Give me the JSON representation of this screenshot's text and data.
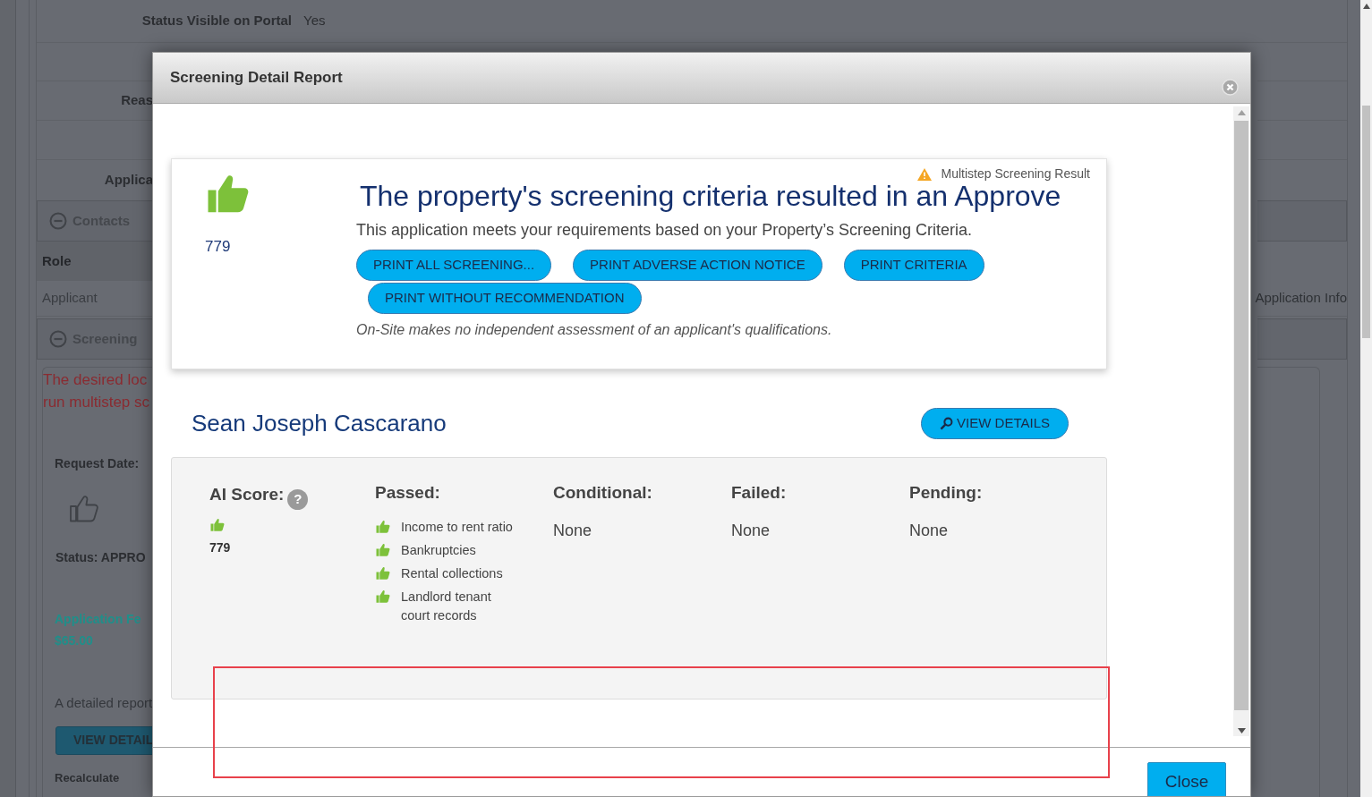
{
  "background": {
    "status_field": {
      "label": "Status Visible on Portal",
      "value": "Yes"
    },
    "labels": [
      "Reas",
      "Applica"
    ],
    "contacts_section": {
      "title": "Contacts",
      "expanded": true,
      "column": "Role",
      "cell": "Applicant"
    },
    "screening_section": {
      "title": "Screening",
      "expanded": true,
      "alert_lines": [
        "The desired loc",
        "run multistep sc"
      ],
      "request_date": "Request Date:",
      "status": "Status: APPRO",
      "fee_label": "Application Fe",
      "fee_value": "$65.00",
      "report_text": "A detailed report",
      "button": "VIEW DETAIL",
      "footer_label": "Recalculate"
    },
    "right_label": "Application Info"
  },
  "modal": {
    "title": "Screening Detail Report",
    "result": {
      "badge": "Multistep Screening Result",
      "score": "779",
      "headline": "The property's screening criteria resulted in an Approve",
      "subtitle": "This application meets your requirements based on your Property’s Screening Criteria.",
      "buttons": [
        "PRINT ALL SCREENING...",
        "PRINT ADVERSE ACTION NOTICE",
        "PRINT CRITERIA",
        "PRINT WITHOUT RECOMMENDATION"
      ],
      "disclaimer": "On-Site makes no independent assessment of an applicant's qualifications."
    },
    "applicant": {
      "name": "Sean Joseph Cascarano",
      "button": "VIEW DETAILS"
    },
    "summary": {
      "ai_score": {
        "label": "AI Score:",
        "help": "?",
        "value": "779"
      },
      "columns": [
        {
          "kind": "list",
          "label": "Passed:",
          "items": [
            "Income to rent ratio",
            "Bankruptcies",
            "Rental collections",
            "Landlord tenant court records"
          ]
        },
        {
          "kind": "text",
          "label": "Conditional:",
          "value": "None"
        },
        {
          "kind": "text",
          "label": "Failed:",
          "value": "None"
        },
        {
          "kind": "text",
          "label": "Pending:",
          "value": "None"
        }
      ]
    },
    "close_button": "Close"
  },
  "annotations": [
    {
      "kind": "rectangle"
    }
  ]
}
